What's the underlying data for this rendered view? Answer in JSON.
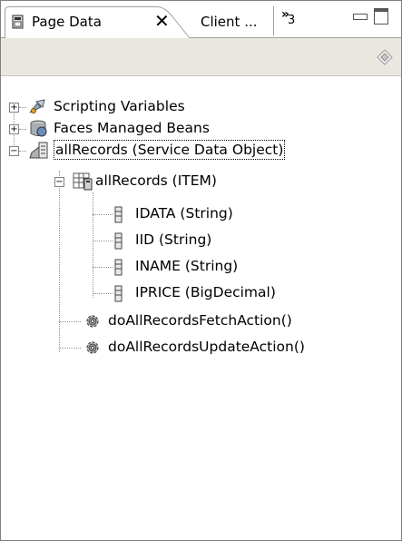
{
  "tabs": {
    "active": {
      "label": "Page Data",
      "close_glyph": "✕"
    },
    "second": {
      "label": "Client ..."
    },
    "overflow": {
      "glyph": "»",
      "count": "3"
    }
  },
  "tree": {
    "scripting_variables": "Scripting Variables",
    "faces_managed_beans": "Faces Managed Beans",
    "all_records_sdo": "allRecords (Service Data Object)",
    "all_records_item": "allRecords (ITEM)",
    "fields": [
      "IDATA (String)",
      "IID (String)",
      "INAME (String)",
      "IPRICE (BigDecimal)"
    ],
    "actions": [
      "doAllRecordsFetchAction()",
      "doAllRecordsUpdateAction()"
    ]
  },
  "colors": {
    "toolbar_bg": "#e9e7df",
    "tab_border": "#a0a0a0",
    "tree_line": "#909090"
  },
  "icons": {
    "tab": "page-data-icon",
    "toolbar": "diamond-menu-icon",
    "scripting": "scripting-variables-icon",
    "beans": "managed-bean-icon",
    "sdo": "service-data-object-icon",
    "item": "data-table-icon",
    "field": "field-icon",
    "action": "action-gear-icon"
  }
}
